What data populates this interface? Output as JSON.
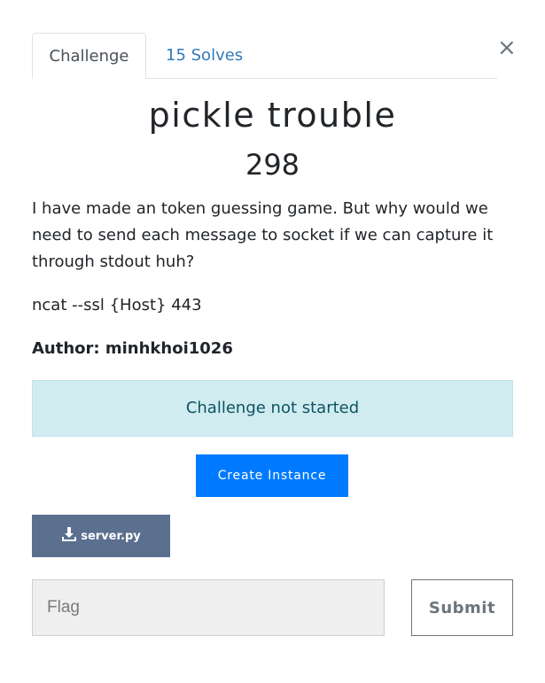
{
  "tabs": {
    "challenge": "Challenge",
    "solves": "15 Solves"
  },
  "close_symbol": "×",
  "challenge": {
    "name": "pickle trouble",
    "points": "298",
    "description": "I have made an token guessing game. But why would we need to send each message to socket if we can capture it through stdout huh?",
    "connection": "ncat --ssl {Host} 443",
    "author": "Author: minhkhoi1026"
  },
  "instance": {
    "status": "Challenge not started",
    "create_label": "Create Instance"
  },
  "file": {
    "label": "server.py",
    "icon": "download-icon"
  },
  "flag": {
    "placeholder": "Flag",
    "value": "",
    "submit_label": "Submit"
  },
  "colors": {
    "tab_link": "#337ab7",
    "status_bg": "#d1ecf1",
    "status_text": "#0c5460",
    "primary": "#007bff",
    "file_button": "#5b6f8f"
  }
}
